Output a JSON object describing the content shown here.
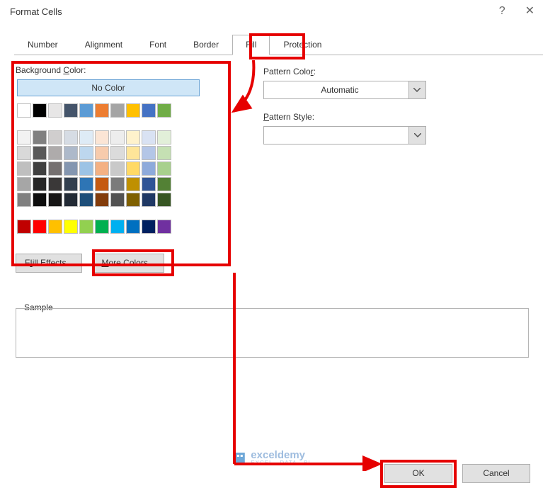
{
  "title": "Format Cells",
  "titlebar": {
    "help": "?",
    "close": "✕"
  },
  "tabs": {
    "number": "Number",
    "alignment": "Alignment",
    "font": "Font",
    "border": "Border",
    "fill": "Fill",
    "protection": "Protection"
  },
  "fill": {
    "bg_label_pre": "Background ",
    "bg_label_u": "C",
    "bg_label_post": "olor:",
    "no_color": "No Color",
    "fill_effects_u": "I",
    "fill_effects_rest": "ill Effects...",
    "fill_effects_pre": "F",
    "more_colors_u": "M",
    "more_colors_rest": "ore Colors..."
  },
  "pattern": {
    "color_label_pre": "Pattern Colo",
    "color_label_u": "r",
    "color_label_post": ":",
    "color_value": "Automatic",
    "style_label_u": "P",
    "style_label_rest": "attern Style:",
    "style_value": ""
  },
  "sample_label": "Sample",
  "footer": {
    "ok": "OK",
    "cancel": "Cancel"
  },
  "watermark": {
    "brand": "exceldemy",
    "sub": "EXCEL · DATA · BI"
  },
  "palette": {
    "row1": [
      "#ffffff",
      "#000000",
      "#e7e6e6",
      "#44546a",
      "#5b9bd5",
      "#ed7d31",
      "#a5a5a5",
      "#ffc000",
      "#4472c4",
      "#70ad47"
    ],
    "row2": [
      "#f2f2f2",
      "#808080",
      "#d0cece",
      "#d6dce4",
      "#deebf6",
      "#fbe5d5",
      "#ededed",
      "#fff2cc",
      "#d9e2f3",
      "#e2efd9"
    ],
    "row3": [
      "#d9d9d9",
      "#595959",
      "#aeabab",
      "#adb9ca",
      "#bdd7ee",
      "#f7cbac",
      "#dbdbdb",
      "#fee599",
      "#b4c6e7",
      "#c5e0b3"
    ],
    "row4": [
      "#bfbfbf",
      "#404040",
      "#757070",
      "#8496b0",
      "#9cc3e5",
      "#f4b183",
      "#c9c9c9",
      "#ffd965",
      "#8eaadb",
      "#a8d08d"
    ],
    "row5": [
      "#a6a6a6",
      "#262626",
      "#3a3838",
      "#323f4f",
      "#2e75b5",
      "#c55a11",
      "#7b7b7b",
      "#bf9000",
      "#2f5496",
      "#538135"
    ],
    "row6": [
      "#808080",
      "#0d0d0d",
      "#171616",
      "#222a35",
      "#1e4e79",
      "#833c0b",
      "#525252",
      "#7f6000",
      "#1f3864",
      "#375623"
    ],
    "row7": [
      "#c00000",
      "#ff0000",
      "#ffc000",
      "#ffff00",
      "#92d050",
      "#00b050",
      "#00b0f0",
      "#0070c0",
      "#002060",
      "#7030a0"
    ]
  }
}
